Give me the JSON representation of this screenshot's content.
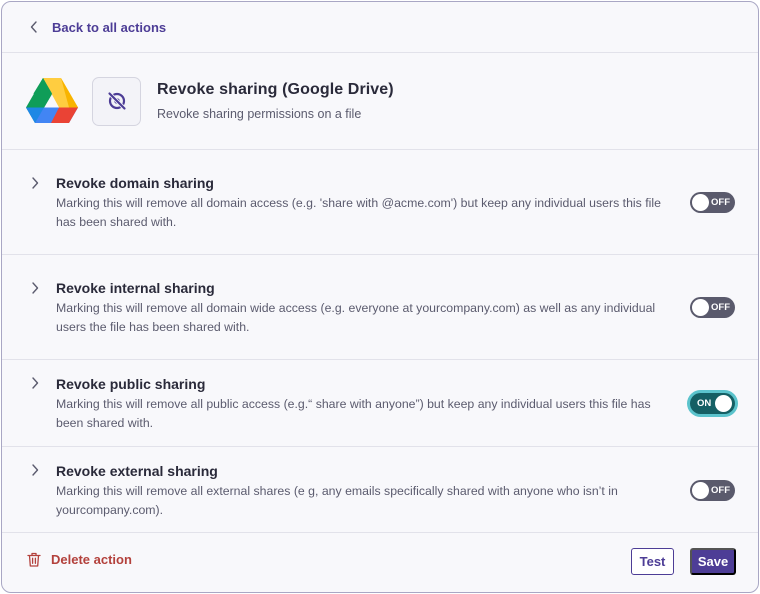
{
  "nav": {
    "back_label": "Back to all actions"
  },
  "header": {
    "title": "Revoke sharing (Google Drive)",
    "subtitle": "Revoke sharing permissions on a file"
  },
  "options": [
    {
      "title": "Revoke domain sharing",
      "description": "Marking this will remove all domain access (e.g. 'share with @acme.com') but keep any individual users this file has been shared with.",
      "state": "OFF"
    },
    {
      "title": "Revoke internal sharing",
      "description": "Marking this will remove all domain wide access (e.g. everyone at yourcompany.com) as well as any individual users the file has been shared with.",
      "state": "OFF"
    },
    {
      "title": "Revoke public sharing",
      "description": "Marking this will remove all public access (e.g.“ share with anyone”) but keep any individual users this file has been shared with.",
      "state": "ON"
    },
    {
      "title": "Revoke external sharing",
      "description": "Marking this will remove all external shares (e g, any emails specifically shared with anyone who isn’t in yourcompany.com).",
      "state": "OFF"
    }
  ],
  "footer": {
    "delete_label": "Delete action",
    "test_label": "Test",
    "save_label": "Save"
  },
  "colors": {
    "accent": "#4d3d96",
    "danger": "#b3413c",
    "toggle_on": "#155f64",
    "toggle_off": "#5a5a6c"
  },
  "icons": {
    "back": "chevron-left-icon",
    "integration": "google-drive-icon",
    "action": "eye-off-icon",
    "expand": "chevron-right-icon",
    "delete": "trash-icon"
  }
}
